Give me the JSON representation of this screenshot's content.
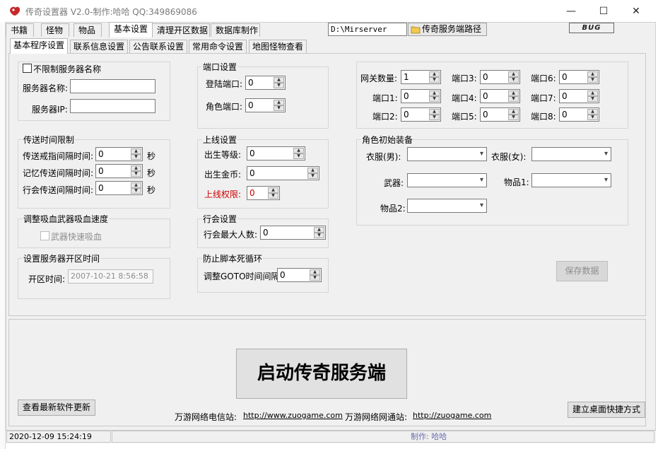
{
  "window": {
    "title": "传奇设置器 V2.0-制作:哈哈 QQ:349869086",
    "minimize": "—",
    "maximize": "☐",
    "close": "✕"
  },
  "main_tabs": [
    "书籍",
    "怪物",
    "物品",
    "基本设置",
    "清理开区数据",
    "数据库制作"
  ],
  "sub_tabs": [
    "基本程序设置",
    "联系信息设置",
    "公告联系设置",
    "常用命令设置",
    "地图怪物查看"
  ],
  "server_path": {
    "value": "D:\\Mirserver",
    "button_label": "传奇服务端路径"
  },
  "logo_text": "BUG",
  "server_name_group": {
    "checkbox_label": "不限制服务器名称",
    "name_label": "服务器名称:",
    "ip_label": "服务器IP:",
    "name_value": "",
    "ip_value": ""
  },
  "port_group": {
    "title": "端口设置",
    "login_port_label": "登陆端口:",
    "login_port_value": "0",
    "role_port_label": "角色端口:",
    "role_port_value": "0"
  },
  "gateway_group": {
    "count_label": "网关数量:",
    "count_value": "1",
    "ports": [
      {
        "label": "端口1:",
        "value": "0"
      },
      {
        "label": "端口2:",
        "value": "0"
      },
      {
        "label": "端口3:",
        "value": "0"
      },
      {
        "label": "端口4:",
        "value": "0"
      },
      {
        "label": "端口5:",
        "value": "0"
      },
      {
        "label": "端口6:",
        "value": "0"
      },
      {
        "label": "端口7:",
        "value": "0"
      },
      {
        "label": "端口8:",
        "value": "0"
      }
    ]
  },
  "transfer_group": {
    "title": "传送时间限制",
    "rows": [
      {
        "label": "传送戒指间隔时间:",
        "value": "0",
        "unit": "秒"
      },
      {
        "label": "记忆传送间隔时间:",
        "value": "0",
        "unit": "秒"
      },
      {
        "label": "行会传送间隔时间:",
        "value": "0",
        "unit": "秒"
      }
    ]
  },
  "online_group": {
    "title": "上线设置",
    "level_label": "出生等级:",
    "level_value": "0",
    "gold_label": "出生金币:",
    "gold_value": "0",
    "perm_label": "上线权限:",
    "perm_value": "0"
  },
  "equip_group": {
    "title": "角色初始装备",
    "clothes_male": "衣服(男):",
    "clothes_female": "衣服(女):",
    "weapon": "武器:",
    "item1": "物品1:",
    "item2": "物品2:"
  },
  "vampire_group": {
    "title": "调整吸血武器吸血速度",
    "checkbox_label": "武器快速吸血"
  },
  "guild_group": {
    "title": "行会设置",
    "max_label": "行会最大人数:",
    "max_value": "0"
  },
  "open_time_group": {
    "title": "设置服务器开区时间",
    "label": "开区时间:",
    "value": "2007-10-21  8:56:58"
  },
  "loop_group": {
    "title": "防止脚本死循环",
    "label": "调整GOTO时间间隔:",
    "value": "0"
  },
  "buttons": {
    "save": "保存数据",
    "start": "启动传奇服务端",
    "check_update": "查看最新软件更新",
    "create_shortcut": "建立桌面快捷方式"
  },
  "footer": {
    "telecom_label": "万游网络电信站:",
    "telecom_url": "http://www.zuogame.com",
    "netcom_label": "万游网络网通站:",
    "netcom_url": "http://zuogame.com"
  },
  "status": {
    "datetime": "2020-12-09  15:24:19",
    "author": "制作: 哈哈"
  },
  "colors": {
    "warning_label": "#cc0000",
    "status_author": "#6b6baf"
  }
}
